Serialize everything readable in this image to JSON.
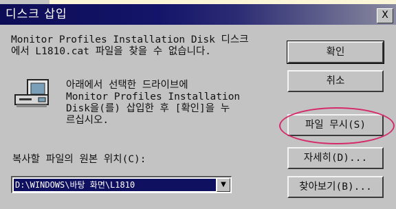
{
  "dialog": {
    "title": "디스크 삽입",
    "close_label": "X",
    "message": "Monitor Profiles Installation Disk 디스크\n에서 L1810.cat 파일을 찾을 수 없습니다.",
    "instruction": "아래에서 선택한 드라이브에\nMonitor Profiles Installation\nDisk을(를) 삽입한 후 [확인]을 누\n르십시오.",
    "path_label": "복사할 파일의 원본 위치(C):",
    "path_value": "D:\\WINDOWS\\바탕 화면\\L1810",
    "icons": {
      "computer": "computer-drive-icon",
      "dropdown": "chevron-down-icon"
    }
  },
  "buttons": {
    "ok": "확인",
    "cancel": "취소",
    "skip": "파일 무시(S)",
    "details": "자세히(D)...",
    "browse": "찾아보기(B)..."
  },
  "colors": {
    "title_bar": "#0d0d56",
    "dialog_bg": "#c3c3c3",
    "annotation_circle": "#d6296a",
    "selection": "#101060"
  }
}
